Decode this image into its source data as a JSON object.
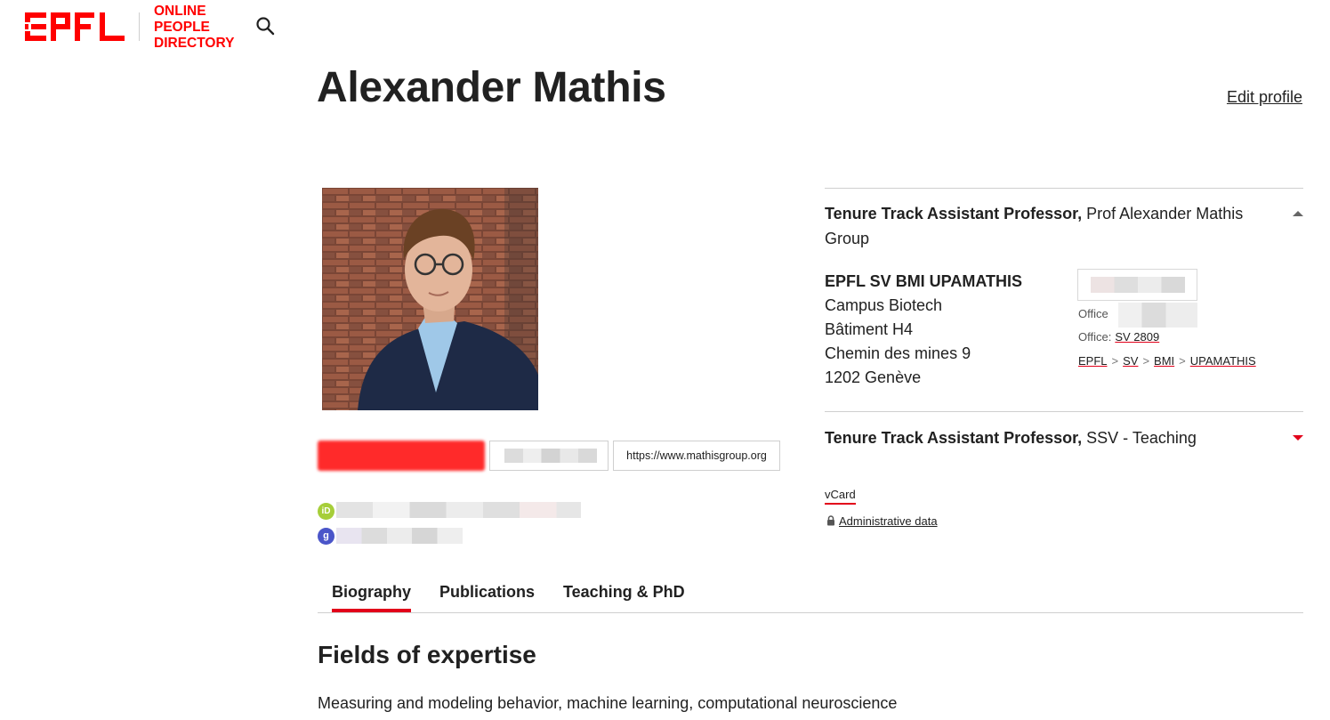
{
  "header": {
    "logo_text": "EPFL",
    "site_name": [
      "ONLINE",
      "PEOPLE",
      "DIRECTORY"
    ],
    "search_icon": "search-icon"
  },
  "profile": {
    "name": "Alexander Mathis",
    "edit_label": "Edit profile",
    "website_label": "https://www.mathisgroup.org"
  },
  "positions": [
    {
      "title": "Tenure Track Assistant Professor,",
      "unit_name": "Prof Alexander Mathis Group",
      "expanded": true,
      "address": {
        "unit": "EPFL SV BMI UPAMATHIS",
        "line1": "Campus Biotech",
        "line2": "Bâtiment H4",
        "line3": "Chemin des mines 9",
        "line4": "1202 Genève"
      },
      "office_label": "Office",
      "office_label_colon": "Office:",
      "office_link": "SV 2809",
      "breadcrumb": [
        "EPFL",
        "SV",
        "BMI",
        "UPAMATHIS"
      ],
      "breadcrumb_sep": ">"
    },
    {
      "title": "Tenure Track Assistant Professor,",
      "unit_name": "SSV - Teaching",
      "expanded": false
    }
  ],
  "links": {
    "vcard": "vCard",
    "admin_data": "Administrative data"
  },
  "tabs": [
    {
      "label": "Biography",
      "active": true
    },
    {
      "label": "Publications",
      "active": false
    },
    {
      "label": "Teaching & PhD",
      "active": false
    }
  ],
  "biography": {
    "section_title": "Fields of expertise",
    "text": "Measuring and modeling behavior, machine learning, computational neuroscience"
  },
  "colors": {
    "accent": "#e2001a",
    "brand_red": "#ff0000",
    "text": "#212121"
  }
}
